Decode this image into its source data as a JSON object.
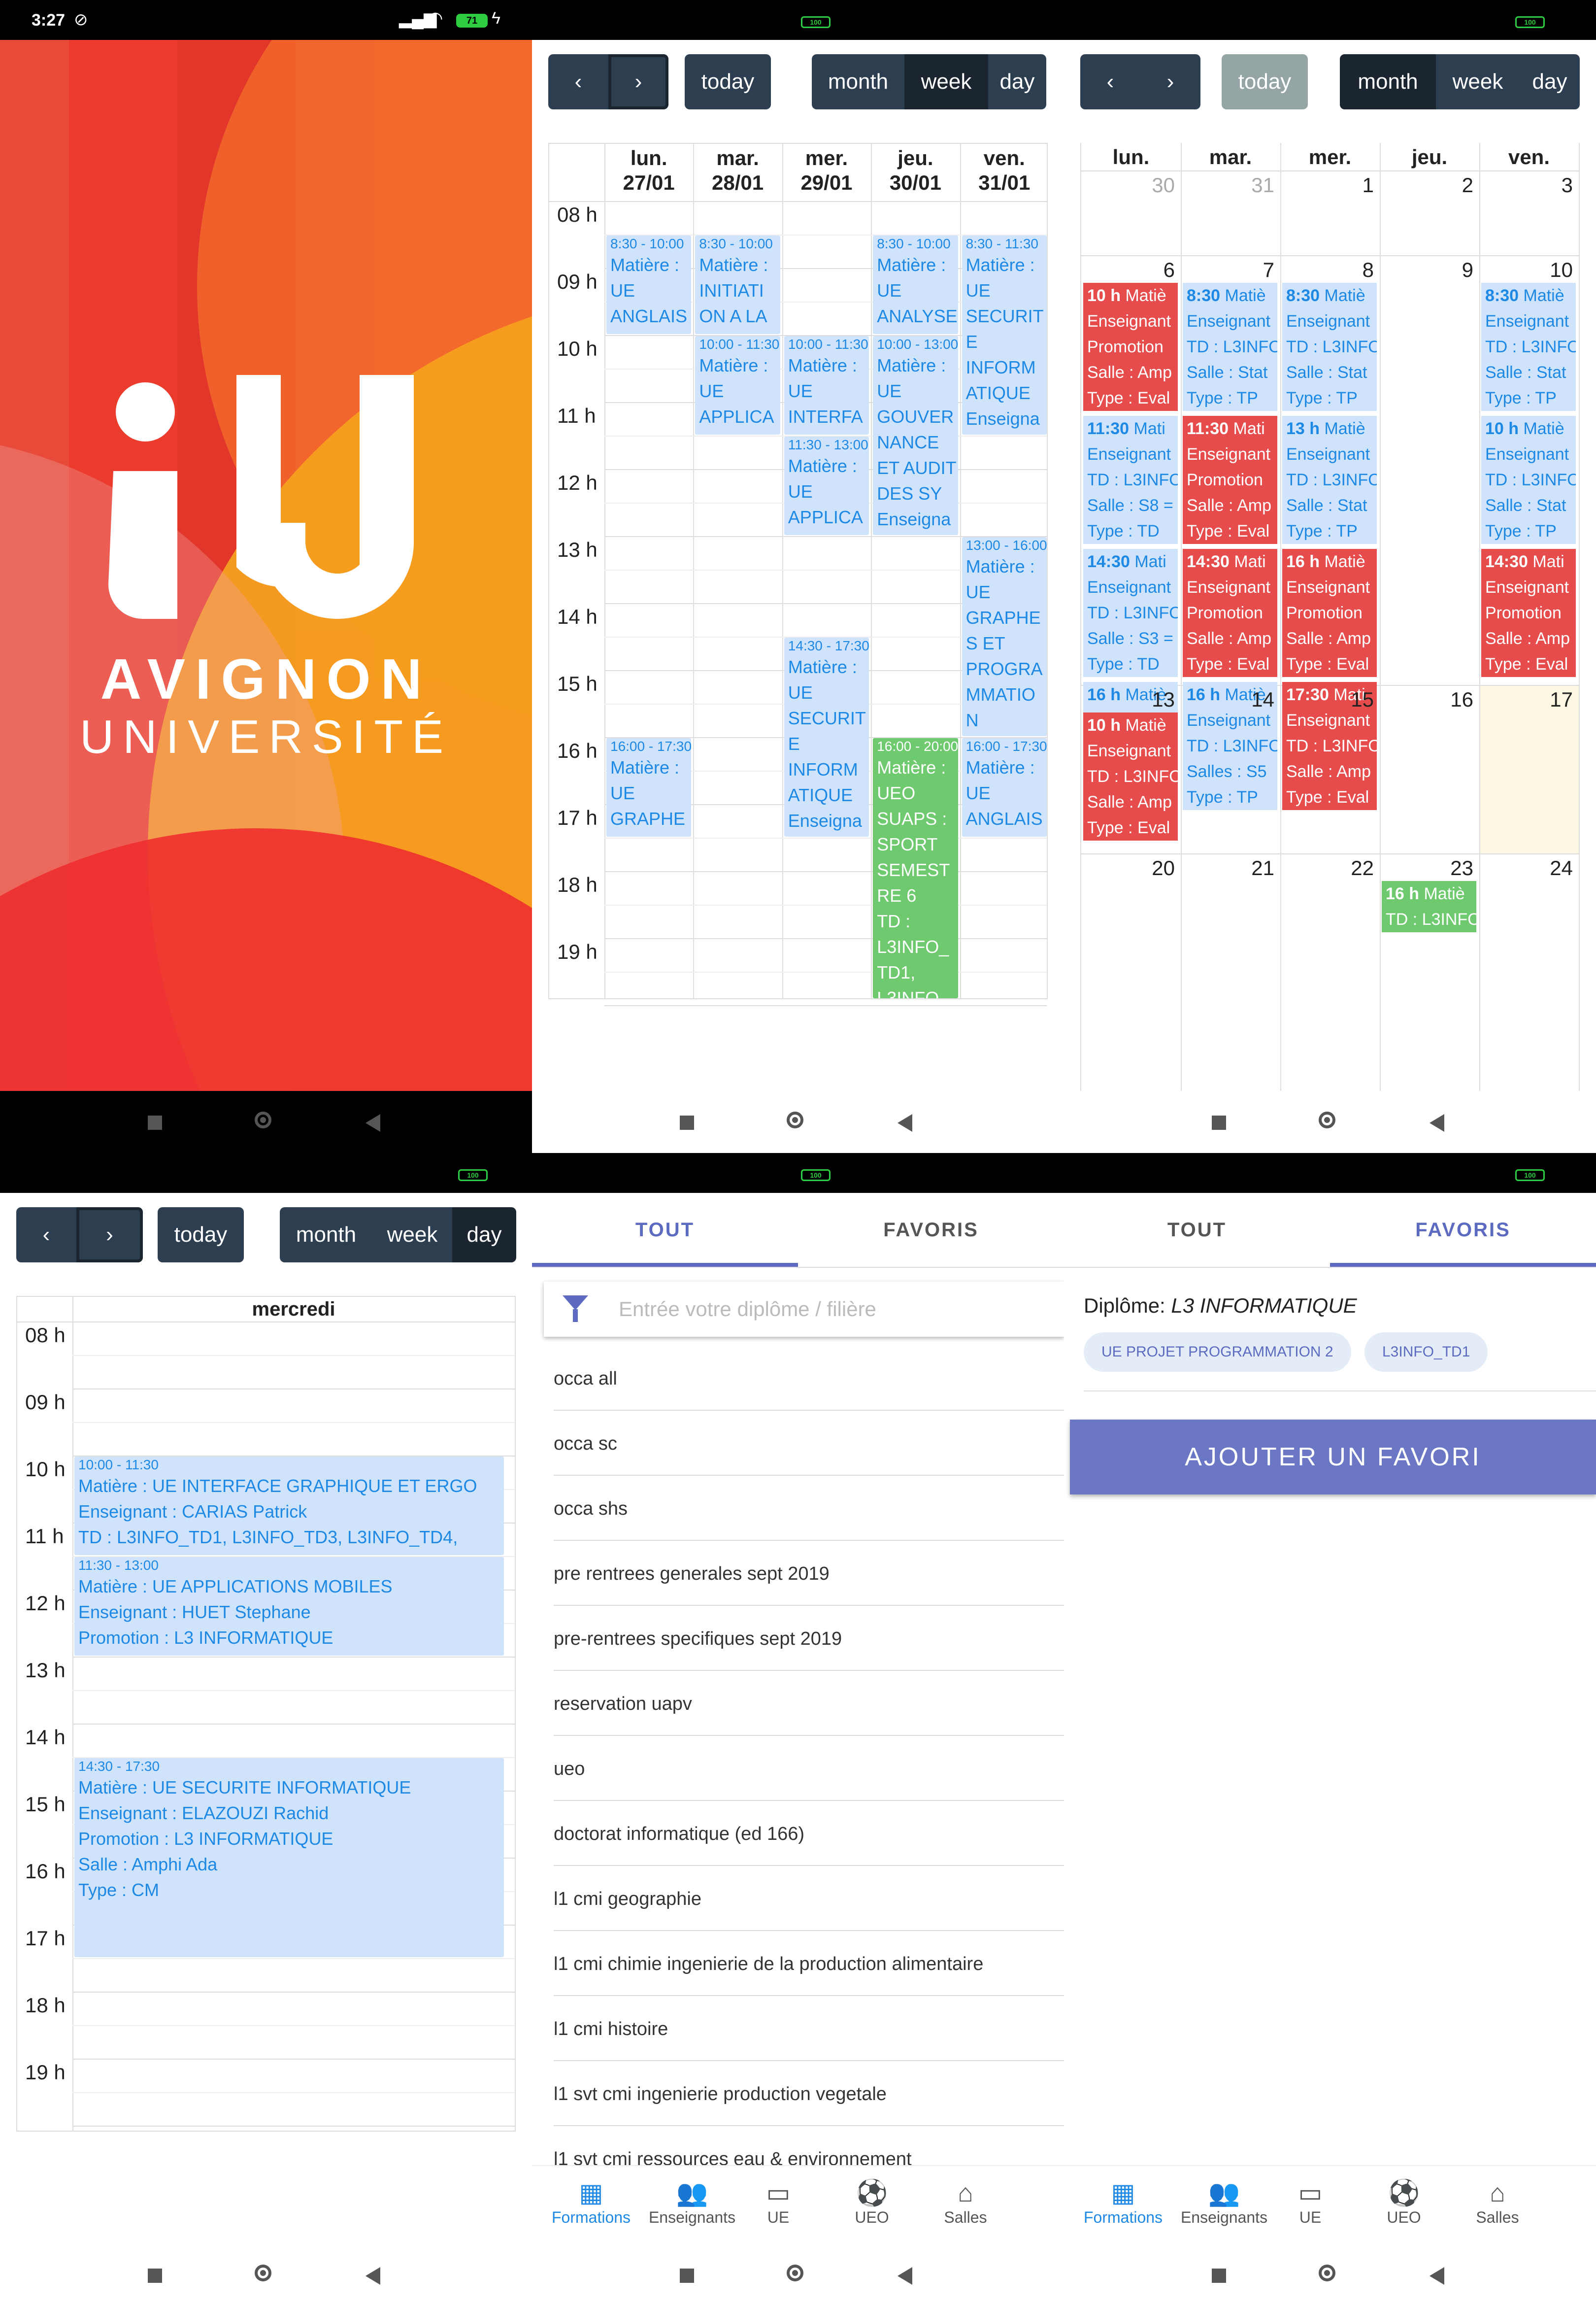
{
  "status": {
    "time": "3:27",
    "battery": "71",
    "battery_full": "100"
  },
  "splash": {
    "line1": "AVIGNON",
    "line2": "UNIVERSITÉ"
  },
  "toolbar": {
    "today": "today",
    "month": "month",
    "week": "week",
    "day": "day",
    "prev_icon": "chevron-left-icon",
    "next_icon": "chevron-right-icon"
  },
  "week_view": {
    "days": [
      {
        "name": "lun.",
        "date": "27/01"
      },
      {
        "name": "mar.",
        "date": "28/01"
      },
      {
        "name": "mer.",
        "date": "29/01"
      },
      {
        "name": "jeu.",
        "date": "30/01"
      },
      {
        "name": "ven.",
        "date": "31/01"
      }
    ],
    "hours": [
      "08 h",
      "09 h",
      "10 h",
      "11 h",
      "12 h",
      "13 h",
      "14 h",
      "15 h",
      "16 h",
      "17 h",
      "18 h",
      "19 h"
    ],
    "events": [
      {
        "day": 0,
        "time": "8:30 - 10:00",
        "lines": [
          "Matière :",
          "UE",
          "ANGLAIS"
        ],
        "color": "blue",
        "start": 8.5,
        "end": 10
      },
      {
        "day": 1,
        "time": "8:30 - 10:00",
        "lines": [
          "Matière :",
          "INITIATI",
          "ON A LA"
        ],
        "color": "blue",
        "start": 8.5,
        "end": 10
      },
      {
        "day": 3,
        "time": "8:30 - 10:00",
        "lines": [
          "Matière :",
          "UE",
          "ANALYSE"
        ],
        "color": "blue",
        "start": 8.5,
        "end": 10
      },
      {
        "day": 4,
        "time": "8:30 - 11:30",
        "lines": [
          "Matière :",
          "UE",
          "SECURIT",
          "E",
          "INFORM",
          "ATIQUE",
          "Enseigna"
        ],
        "color": "blue",
        "start": 8.5,
        "end": 11.5
      },
      {
        "day": 1,
        "time": "10:00 - 11:30",
        "lines": [
          "Matière :",
          "UE",
          "APPLICA"
        ],
        "color": "blue",
        "start": 10,
        "end": 11.5
      },
      {
        "day": 2,
        "time": "10:00 - 11:30",
        "lines": [
          "Matière :",
          "UE",
          "INTERFA"
        ],
        "color": "blue",
        "start": 10,
        "end": 11.5
      },
      {
        "day": 3,
        "time": "10:00 - 13:00",
        "lines": [
          "Matière :",
          "UE",
          "GOUVER",
          "NANCE",
          "ET AUDIT",
          "DES SY",
          "Enseigna"
        ],
        "color": "blue",
        "start": 10,
        "end": 13
      },
      {
        "day": 2,
        "time": "11:30 - 13:00",
        "lines": [
          "Matière :",
          "UE",
          "APPLICA"
        ],
        "color": "blue",
        "start": 11.5,
        "end": 13
      },
      {
        "day": 4,
        "time": "13:00 - 16:00",
        "lines": [
          "Matière :",
          "UE",
          "GRAPHE",
          "S ET",
          "PROGRA",
          "MMATIO",
          "N"
        ],
        "color": "blue",
        "start": 13,
        "end": 16
      },
      {
        "day": 2,
        "time": "14:30 - 17:30",
        "lines": [
          "Matière :",
          "UE",
          "SECURIT",
          "E",
          "INFORM",
          "ATIQUE",
          "Enseigna"
        ],
        "color": "blue",
        "start": 14.5,
        "end": 17.5
      },
      {
        "day": 0,
        "time": "16:00 - 17:30",
        "lines": [
          "Matière :",
          "UE",
          "GRAPHE"
        ],
        "color": "blue",
        "start": 16,
        "end": 17.5
      },
      {
        "day": 3,
        "time": "16:00 - 20:00",
        "lines": [
          "Matière :",
          "UEO",
          "SUAPS :",
          "SPORT",
          "SEMEST",
          "RE 6",
          "TD :",
          "L3INFO_",
          "TD1,",
          "L3INFO_"
        ],
        "color": "green",
        "start": 16,
        "end": 20
      },
      {
        "day": 4,
        "time": "16:00 - 17:30",
        "lines": [
          "Matière :",
          "UE",
          "ANGLAIS"
        ],
        "color": "blue",
        "start": 16,
        "end": 17.5
      }
    ]
  },
  "month_view": {
    "weekdays": [
      "lun.",
      "mar.",
      "mer.",
      "jeu.",
      "ven."
    ],
    "weeks": [
      {
        "days": [
          "30",
          "31",
          "1",
          "2",
          "3"
        ],
        "other": [
          true,
          true,
          false,
          false,
          false
        ],
        "events": []
      },
      {
        "days": [
          "6",
          "7",
          "8",
          "9",
          "10"
        ],
        "other": [
          false,
          false,
          false,
          false,
          false
        ],
        "events": [
          {
            "col": 0,
            "row": 0,
            "color": "red",
            "head": "10 h",
            "lines": [
              "Matiè",
              "Enseignant",
              "Promotion",
              "Salle : Amp",
              "Type : Eval"
            ]
          },
          {
            "col": 1,
            "row": 0,
            "color": "blue",
            "head": "8:30",
            "lines": [
              "Matiè",
              "Enseignant",
              "TD : L3INFO",
              "Salle : Stat",
              "Type : TP"
            ]
          },
          {
            "col": 2,
            "row": 0,
            "color": "blue",
            "head": "8:30",
            "lines": [
              "Matiè",
              "Enseignant",
              "TD : L3INFO",
              "Salle : Stat",
              "Type : TP"
            ]
          },
          {
            "col": 4,
            "row": 0,
            "color": "blue",
            "head": "8:30",
            "lines": [
              "Matiè",
              "Enseignant",
              "TD : L3INFO",
              "Salle : Stat",
              "Type : TP"
            ]
          },
          {
            "col": 0,
            "row": 1,
            "color": "blue",
            "head": "11:30",
            "lines": [
              "Mati",
              "Enseignant",
              "TD : L3INFO",
              "Salle : S8 =",
              "Type : TD"
            ]
          },
          {
            "col": 1,
            "row": 1,
            "color": "red",
            "head": "11:30",
            "lines": [
              "Mati",
              "Enseignant",
              "Promotion",
              "Salle : Amp",
              "Type : Eval"
            ]
          },
          {
            "col": 2,
            "row": 1,
            "color": "blue",
            "head": "13 h",
            "lines": [
              "Matiè",
              "Enseignant",
              "TD : L3INFO",
              "Salle : Stat",
              "Type : TP"
            ]
          },
          {
            "col": 4,
            "row": 1,
            "color": "blue",
            "head": "10 h",
            "lines": [
              "Matiè",
              "Enseignant",
              "TD : L3INFO",
              "Salle : Stat",
              "Type : TP"
            ]
          },
          {
            "col": 0,
            "row": 2,
            "color": "blue",
            "head": "14:30",
            "lines": [
              "Mati",
              "Enseignant",
              "TD : L3INFO",
              "Salle : S3 =",
              "Type : TD"
            ]
          },
          {
            "col": 1,
            "row": 2,
            "color": "red",
            "head": "14:30",
            "lines": [
              "Mati",
              "Enseignant",
              "Promotion",
              "Salle : Amp",
              "Type : Eval"
            ]
          },
          {
            "col": 2,
            "row": 2,
            "color": "red",
            "head": "16 h",
            "lines": [
              "Matiè",
              "Enseignant",
              "Promotion",
              "Salle : Amp",
              "Type : Eval"
            ]
          },
          {
            "col": 4,
            "row": 2,
            "color": "red",
            "head": "14:30",
            "lines": [
              "Mati",
              "Enseignant",
              "Promotion",
              "Salle : Amp",
              "Type : Eval"
            ]
          },
          {
            "col": 0,
            "row": 3,
            "color": "blue",
            "head": "16 h",
            "lines": [
              "Matiè",
              "Enseignant",
              "TD : L3INFO",
              "Salle : Stat",
              "Type : TP"
            ]
          },
          {
            "col": 1,
            "row": 3,
            "color": "blue",
            "head": "16 h",
            "lines": [
              "Matiè",
              "Enseignant",
              "TD : L3INFO",
              "Salles : S5",
              "Type : TP"
            ]
          },
          {
            "col": 2,
            "row": 3,
            "color": "red",
            "head": "17:30",
            "lines": [
              "Mati",
              "Enseignant",
              "TD : L3INFO",
              "Salle : Amp",
              "Type : Eval"
            ]
          }
        ]
      },
      {
        "days": [
          "13",
          "14",
          "15",
          "16",
          "17"
        ],
        "other": [
          false,
          false,
          false,
          false,
          false
        ],
        "events": [
          {
            "col": 0,
            "row": 0,
            "color": "red",
            "head": "10 h",
            "lines": [
              "Matiè",
              "Enseignant",
              "TD : L3INFO",
              "Salle : Amp",
              "Type : Eval"
            ]
          }
        ]
      },
      {
        "days": [
          "20",
          "21",
          "22",
          "23",
          "24"
        ],
        "other": [
          false,
          false,
          false,
          false,
          false
        ],
        "events": [
          {
            "col": 3,
            "row": 0,
            "color": "green",
            "head": "16 h",
            "lines": [
              "Matiè",
              "TD : L3INFO"
            ]
          }
        ]
      }
    ]
  },
  "day_view": {
    "header": "mercredi",
    "hours": [
      "08 h",
      "09 h",
      "10 h",
      "11 h",
      "12 h",
      "13 h",
      "14 h",
      "15 h",
      "16 h",
      "17 h",
      "18 h",
      "19 h"
    ],
    "events": [
      {
        "time": "10:00 - 11:30",
        "lines": [
          "Matière : UE INTERFACE GRAPHIQUE ET ERGO",
          "Enseignant : CARIAS Patrick",
          "TD : L3INFO_TD1, L3INFO_TD3, L3INFO_TD4,"
        ],
        "start": 10,
        "end": 11.5
      },
      {
        "time": "11:30 - 13:00",
        "lines": [
          "Matière : UE APPLICATIONS MOBILES",
          "Enseignant : HUET Stephane",
          "Promotion : L3 INFORMATIQUE"
        ],
        "start": 11.5,
        "end": 13
      },
      {
        "time": "14:30 - 17:30",
        "lines": [
          "Matière : UE SECURITE INFORMATIQUE",
          "Enseignant : ELAZOUZI Rachid",
          "Promotion : L3 INFORMATIQUE",
          "Salle : Amphi Ada",
          "Type : CM"
        ],
        "start": 14.5,
        "end": 17.5
      }
    ]
  },
  "tabs": {
    "all": "TOUT",
    "favorites": "FAVORIS"
  },
  "search": {
    "placeholder": "Entrée votre diplôme / filière",
    "icon": "filter-icon"
  },
  "formations": [
    "occa all",
    "occa sc",
    "occa shs",
    "pre rentrees generales sept 2019",
    "pre-rentrees specifiques sept 2019",
    "reservation uapv",
    "ueo",
    "doctorat informatique (ed 166)",
    "l1 cmi geographie",
    "l1 cmi chimie ingenierie de la production alimentaire",
    "l1 cmi histoire",
    "l1 svt cmi ingenierie production vegetale",
    "l1 svt cmi ressources eau & environnement"
  ],
  "favorites": {
    "label": "Diplôme:",
    "value": "L3 INFORMATIQUE",
    "chips": [
      "UE PROJET PROGRAMMATION 2",
      "L3INFO_TD1"
    ],
    "add_button": "AJOUTER UN FAVORI"
  },
  "bottom_nav": [
    {
      "label": "Formations",
      "icon": "calendar-icon"
    },
    {
      "label": "Enseignants",
      "icon": "people-icon"
    },
    {
      "label": "UE",
      "icon": "book-icon"
    },
    {
      "label": "UEO",
      "icon": "ball-icon"
    },
    {
      "label": "Salles",
      "icon": "home-icon"
    }
  ]
}
